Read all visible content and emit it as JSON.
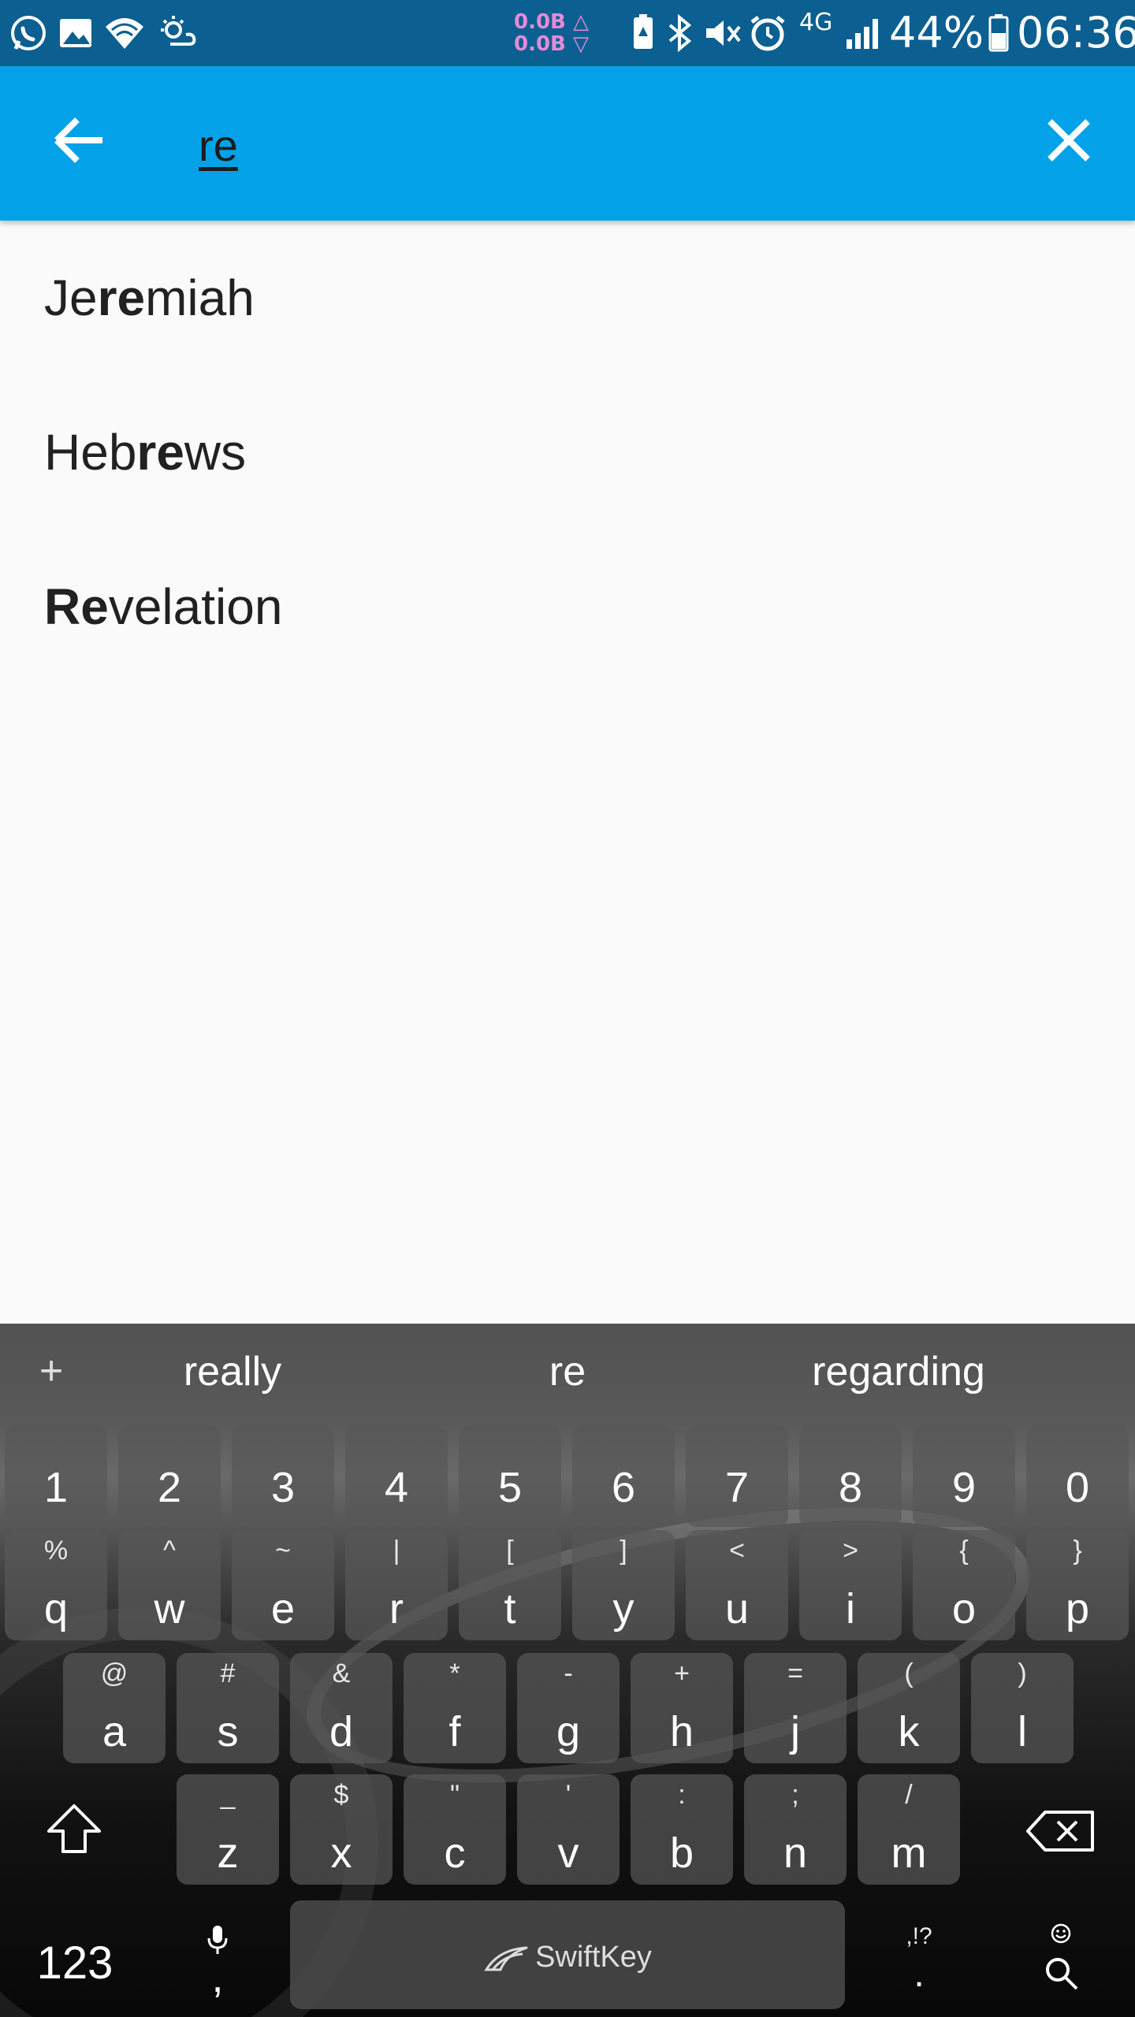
{
  "status_bar": {
    "net_up": "0.0B",
    "net_down": "0.0B",
    "network_type": "4G",
    "battery_percent": "44%",
    "time": "06:36"
  },
  "search": {
    "query": "re",
    "back_icon": "arrow-back-icon",
    "clear_icon": "close-icon"
  },
  "results": [
    {
      "pre": "Je",
      "match": "re",
      "post": "miah"
    },
    {
      "pre": "Heb",
      "match": "re",
      "post": "ws"
    },
    {
      "pre": "",
      "match": "Re",
      "post": "velation"
    }
  ],
  "keyboard": {
    "brand": "SwiftKey",
    "suggestions": [
      "really",
      "re",
      "regarding"
    ],
    "plus": "+",
    "number_row": [
      "1",
      "2",
      "3",
      "4",
      "5",
      "6",
      "7",
      "8",
      "9",
      "0"
    ],
    "row1": [
      {
        "main": "q",
        "alt": "%"
      },
      {
        "main": "w",
        "alt": "^"
      },
      {
        "main": "e",
        "alt": "~"
      },
      {
        "main": "r",
        "alt": "|"
      },
      {
        "main": "t",
        "alt": "["
      },
      {
        "main": "y",
        "alt": "]"
      },
      {
        "main": "u",
        "alt": "<"
      },
      {
        "main": "i",
        "alt": ">"
      },
      {
        "main": "o",
        "alt": "{"
      },
      {
        "main": "p",
        "alt": "}"
      }
    ],
    "row2": [
      {
        "main": "a",
        "alt": "@"
      },
      {
        "main": "s",
        "alt": "#"
      },
      {
        "main": "d",
        "alt": "&"
      },
      {
        "main": "f",
        "alt": "*"
      },
      {
        "main": "g",
        "alt": "-"
      },
      {
        "main": "h",
        "alt": "+"
      },
      {
        "main": "j",
        "alt": "="
      },
      {
        "main": "k",
        "alt": "("
      },
      {
        "main": "l",
        "alt": ")"
      }
    ],
    "row3": [
      {
        "main": "z",
        "alt": "_"
      },
      {
        "main": "x",
        "alt": "$"
      },
      {
        "main": "c",
        "alt": "\""
      },
      {
        "main": "v",
        "alt": "'"
      },
      {
        "main": "b",
        "alt": ":"
      },
      {
        "main": "n",
        "alt": ";"
      },
      {
        "main": "m",
        "alt": "/"
      }
    ],
    "num_switch": "123",
    "comma": ",",
    "punct_alt": ",!?",
    "period": ".",
    "shift_icon": "shift-arrow-icon",
    "backspace_icon": "backspace-icon",
    "mic_icon": "microphone-icon",
    "emoji_icon": "smiley-icon",
    "search_icon": "search-icon"
  }
}
